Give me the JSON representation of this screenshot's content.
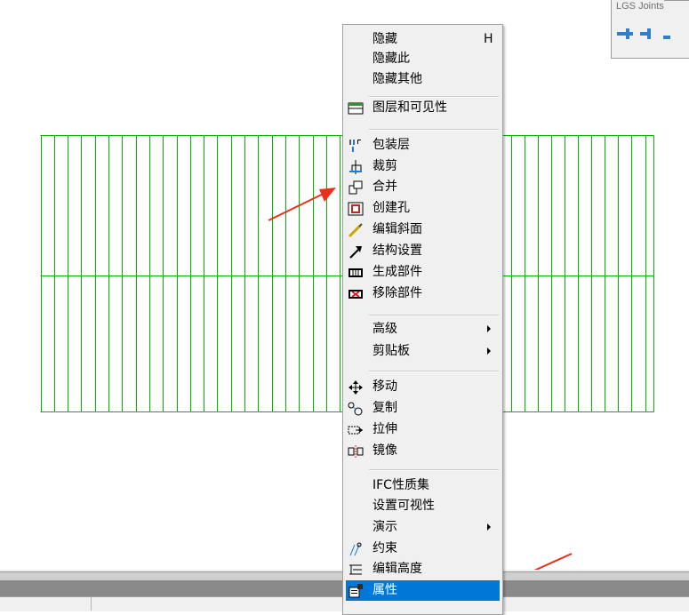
{
  "panel": {
    "title": "LGS Joints"
  },
  "menu": {
    "items": [
      {
        "id": "hide",
        "label": "隐藏",
        "shortcut": "H",
        "icon": ""
      },
      {
        "id": "hide-this",
        "label": "隐藏此",
        "icon": ""
      },
      {
        "id": "hide-others",
        "label": "隐藏其他",
        "icon": ""
      },
      {
        "id": "layers",
        "label": "图层和可见性",
        "icon": "layers-icon"
      },
      {
        "id": "cladding",
        "label": "包装层",
        "icon": "cladding-icon"
      },
      {
        "id": "trim",
        "label": "裁剪",
        "icon": "trim-icon"
      },
      {
        "id": "merge",
        "label": "合并",
        "icon": "merge-icon"
      },
      {
        "id": "create-hole",
        "label": "创建孔",
        "icon": "hole-icon"
      },
      {
        "id": "edit-slope",
        "label": "编辑斜面",
        "icon": "slope-icon"
      },
      {
        "id": "structure",
        "label": "结构设置",
        "icon": "structure-icon"
      },
      {
        "id": "gen-parts",
        "label": "生成部件",
        "icon": "generate-parts-icon"
      },
      {
        "id": "remove-parts",
        "label": "移除部件",
        "icon": "remove-parts-icon"
      },
      {
        "id": "advanced",
        "label": "高级",
        "icon": "",
        "submenu": true
      },
      {
        "id": "clipboard",
        "label": "剪贴板",
        "icon": "",
        "submenu": true
      },
      {
        "id": "move",
        "label": "移动",
        "icon": "move-icon"
      },
      {
        "id": "copy",
        "label": "复制",
        "icon": "copy-icon"
      },
      {
        "id": "stretch",
        "label": "拉伸",
        "icon": "stretch-icon"
      },
      {
        "id": "mirror",
        "label": "镜像",
        "icon": "mirror-icon"
      },
      {
        "id": "ifc",
        "label": "IFC性质集",
        "icon": ""
      },
      {
        "id": "visibility",
        "label": "设置可视性",
        "icon": ""
      },
      {
        "id": "demo",
        "label": "演示",
        "icon": "",
        "submenu": true
      },
      {
        "id": "constraint",
        "label": "约束",
        "icon": "constraint-icon"
      },
      {
        "id": "edit-height",
        "label": "编辑高度",
        "icon": "height-icon"
      },
      {
        "id": "properties",
        "label": "属性",
        "icon": "properties-icon",
        "highlighted": true
      }
    ]
  },
  "colors": {
    "grid": "#00b400",
    "highlight": "#0078d7",
    "arrow": "#e8301c"
  }
}
